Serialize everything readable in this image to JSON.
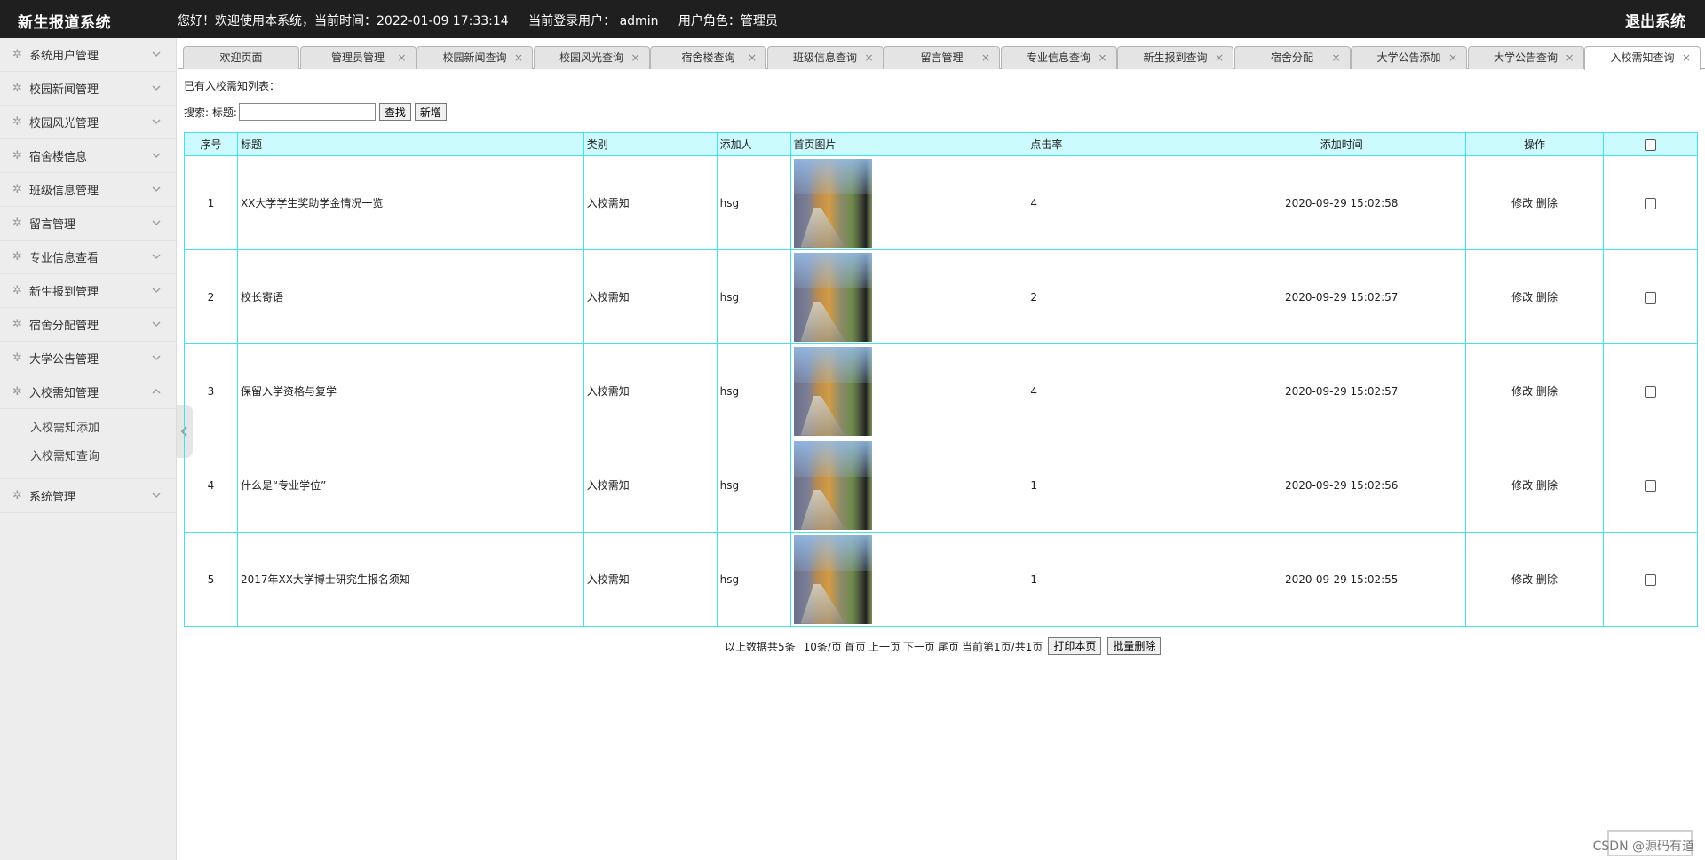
{
  "app": {
    "title": "新生报道系统",
    "greeting": "您好！欢迎使用本系统，当前时间：2022-01-09 17:33:14",
    "current_user": "当前登录用户： admin",
    "role": "用户角色：管理员",
    "logout": "退出系统"
  },
  "sidebar": {
    "items": [
      {
        "label": "系统用户管理"
      },
      {
        "label": "校园新闻管理"
      },
      {
        "label": "校园风光管理"
      },
      {
        "label": "宿舍楼信息"
      },
      {
        "label": "班级信息管理"
      },
      {
        "label": "留言管理"
      },
      {
        "label": "专业信息查看"
      },
      {
        "label": "新生报到管理"
      },
      {
        "label": "宿舍分配管理"
      },
      {
        "label": "大学公告管理"
      },
      {
        "label": "入校需知管理"
      },
      {
        "label": "系统管理"
      }
    ],
    "submenu": [
      "入校需知添加",
      "入校需知查询"
    ]
  },
  "tabs": [
    {
      "label": "欢迎页面"
    },
    {
      "label": "管理员管理"
    },
    {
      "label": "校园新闻查询"
    },
    {
      "label": "校园风光查询"
    },
    {
      "label": "宿舍楼查询"
    },
    {
      "label": "班级信息查询"
    },
    {
      "label": "留言管理"
    },
    {
      "label": "专业信息查询"
    },
    {
      "label": "新生报到查询"
    },
    {
      "label": "宿舍分配"
    },
    {
      "label": "大学公告添加"
    },
    {
      "label": "大学公告查询"
    },
    {
      "label": "入校需知查询"
    }
  ],
  "tab_close": "×",
  "content": {
    "list_title": "已有入校需知列表：",
    "search_label": "搜索: 标题:",
    "search_value": "",
    "find_button": "查找",
    "add_button": "新增"
  },
  "table": {
    "headers": [
      "序号",
      "标题",
      "类别",
      "添加人",
      "首页图片",
      "点击率",
      "添加时间",
      "操作"
    ],
    "rows": [
      {
        "no": "1",
        "title": "XX大学学生奖助学金情况一览",
        "category": "入校需知",
        "author": "hsg",
        "clicks": "4",
        "time": "2020-09-29 15:02:58"
      },
      {
        "no": "2",
        "title": "校长寄语",
        "category": "入校需知",
        "author": "hsg",
        "clicks": "2",
        "time": "2020-09-29 15:02:57"
      },
      {
        "no": "3",
        "title": "保留入学资格与复学",
        "category": "入校需知",
        "author": "hsg",
        "clicks": "4",
        "time": "2020-09-29 15:02:57"
      },
      {
        "no": "4",
        "title": "什么是“专业学位”",
        "category": "入校需知",
        "author": "hsg",
        "clicks": "1",
        "time": "2020-09-29 15:02:56"
      },
      {
        "no": "5",
        "title": "2017年XX大学博士研究生报名须知",
        "category": "入校需知",
        "author": "hsg",
        "clicks": "1",
        "time": "2020-09-29 15:02:55"
      }
    ],
    "edit_label": "修改",
    "delete_label": "删除"
  },
  "pager": {
    "summary": "以上数据共5条",
    "per_page": "10条/页",
    "first": "首页",
    "prev": "上一页",
    "next": "下一页",
    "last": "尾页",
    "current": "当前第1页/共1页",
    "print_button": "打印本页",
    "batch_delete_button": "批量删除"
  },
  "watermark": "CSDN @源码有道"
}
